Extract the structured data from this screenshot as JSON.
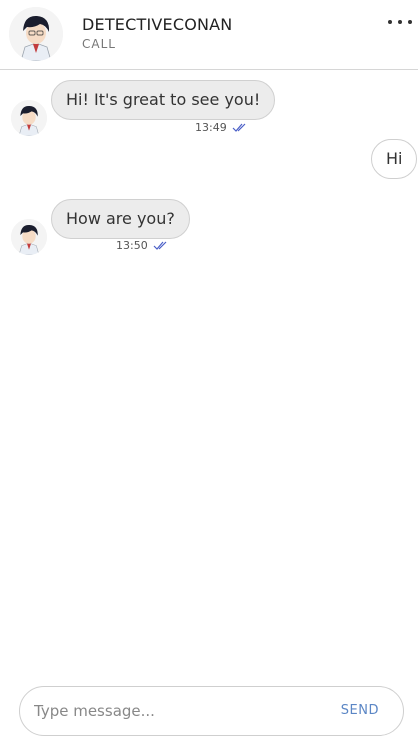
{
  "header": {
    "name": "DETECTIVECONAN",
    "subtitle": "CALL",
    "menu_icon": "more-horizontal-icon"
  },
  "messages": [
    {
      "direction": "incoming",
      "text": "Hi! It's great to see you!",
      "time": "13:49",
      "status": "read-check-icon"
    },
    {
      "direction": "outgoing",
      "text": "Hi"
    },
    {
      "direction": "incoming",
      "text": "How are you?",
      "time": "13:50",
      "status": "read-check-icon"
    }
  ],
  "composer": {
    "placeholder": "Type message...",
    "send_label": "SEND"
  },
  "colors": {
    "accent": "#5b86c5",
    "incoming_bubble": "#ececec",
    "outgoing_bubble": "#ffffff",
    "check": "#4a5fc7"
  }
}
